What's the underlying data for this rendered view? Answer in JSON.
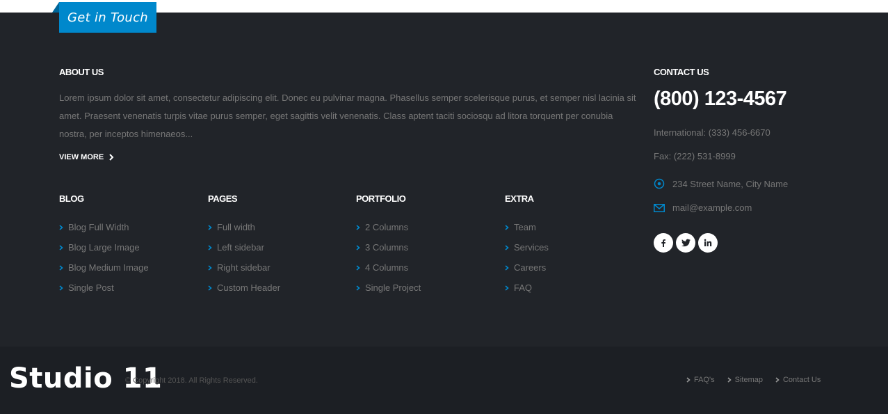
{
  "colors": {
    "accent": "#0088cc",
    "footer_bg": "#212429",
    "copyright_bg": "#1c1f24",
    "text_muted": "#777777"
  },
  "tab": {
    "label": "Get in Touch"
  },
  "about": {
    "heading": "ABOUT US",
    "text": "Lorem ipsum dolor sit amet, consectetur adipiscing elit. Donec eu pulvinar magna. Phasellus semper scelerisque purus, et semper nisl lacinia sit amet. Praesent venenatis turpis vitae purus semper, eget sagittis velit venenatis. Class aptent taciti sociosqu ad litora torquent per conubia nostra, per inceptos himenaeos...",
    "view_more": "VIEW MORE"
  },
  "columns": [
    {
      "heading": "BLOG",
      "items": [
        "Blog Full Width",
        "Blog Large Image",
        "Blog Medium Image",
        "Single Post"
      ]
    },
    {
      "heading": "PAGES",
      "items": [
        "Full width",
        "Left sidebar",
        "Right sidebar",
        "Custom Header"
      ]
    },
    {
      "heading": "PORTFOLIO",
      "items": [
        "2 Columns",
        "3 Columns",
        "4 Columns",
        "Single Project"
      ]
    },
    {
      "heading": "EXTRA",
      "items": [
        "Team",
        "Services",
        "Careers",
        "FAQ"
      ]
    }
  ],
  "contact": {
    "heading": "CONTACT US",
    "phone": "(800) 123-4567",
    "international": "International: (333) 456-6670",
    "fax": "Fax: (222) 531-8999",
    "address": "234 Street Name, City Name",
    "email": "mail@example.com",
    "social_icons": [
      "facebook-icon",
      "twitter-icon",
      "linkedin-icon"
    ]
  },
  "copyright_bar": {
    "logo": "Studio 11",
    "copyright": "© Copyright 2018. All Rights Reserved.",
    "links": [
      "FAQ's",
      "Sitemap",
      "Contact Us"
    ]
  }
}
